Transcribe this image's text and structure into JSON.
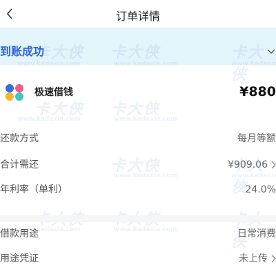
{
  "header": {
    "title": "订单详情"
  },
  "status": {
    "text": "到账成功"
  },
  "product": {
    "name": "极速借钱",
    "amount": "¥880",
    "logo_colors": [
      "#2f6fe0",
      "#f25a8e",
      "#f6b62b",
      "#3cc7c0"
    ]
  },
  "rows": [
    {
      "label": "还款方式",
      "value": "每月等额",
      "chevron": false
    },
    {
      "label": "合计需还",
      "value": "¥909.06",
      "chevron": true
    },
    {
      "label": "年利率（单利）",
      "value": "24.0%",
      "chevron": false
    },
    {
      "label": "借款用途",
      "value": "日常消费",
      "chevron": false
    },
    {
      "label": "用途凭证",
      "value": "未上传",
      "chevron": true
    }
  ],
  "watermark": {
    "brand": "卡大侠",
    "url": "www.kadaxia.com"
  },
  "colors": {
    "accent": "#2b66d2",
    "status_bg": "#e4f4fb"
  }
}
